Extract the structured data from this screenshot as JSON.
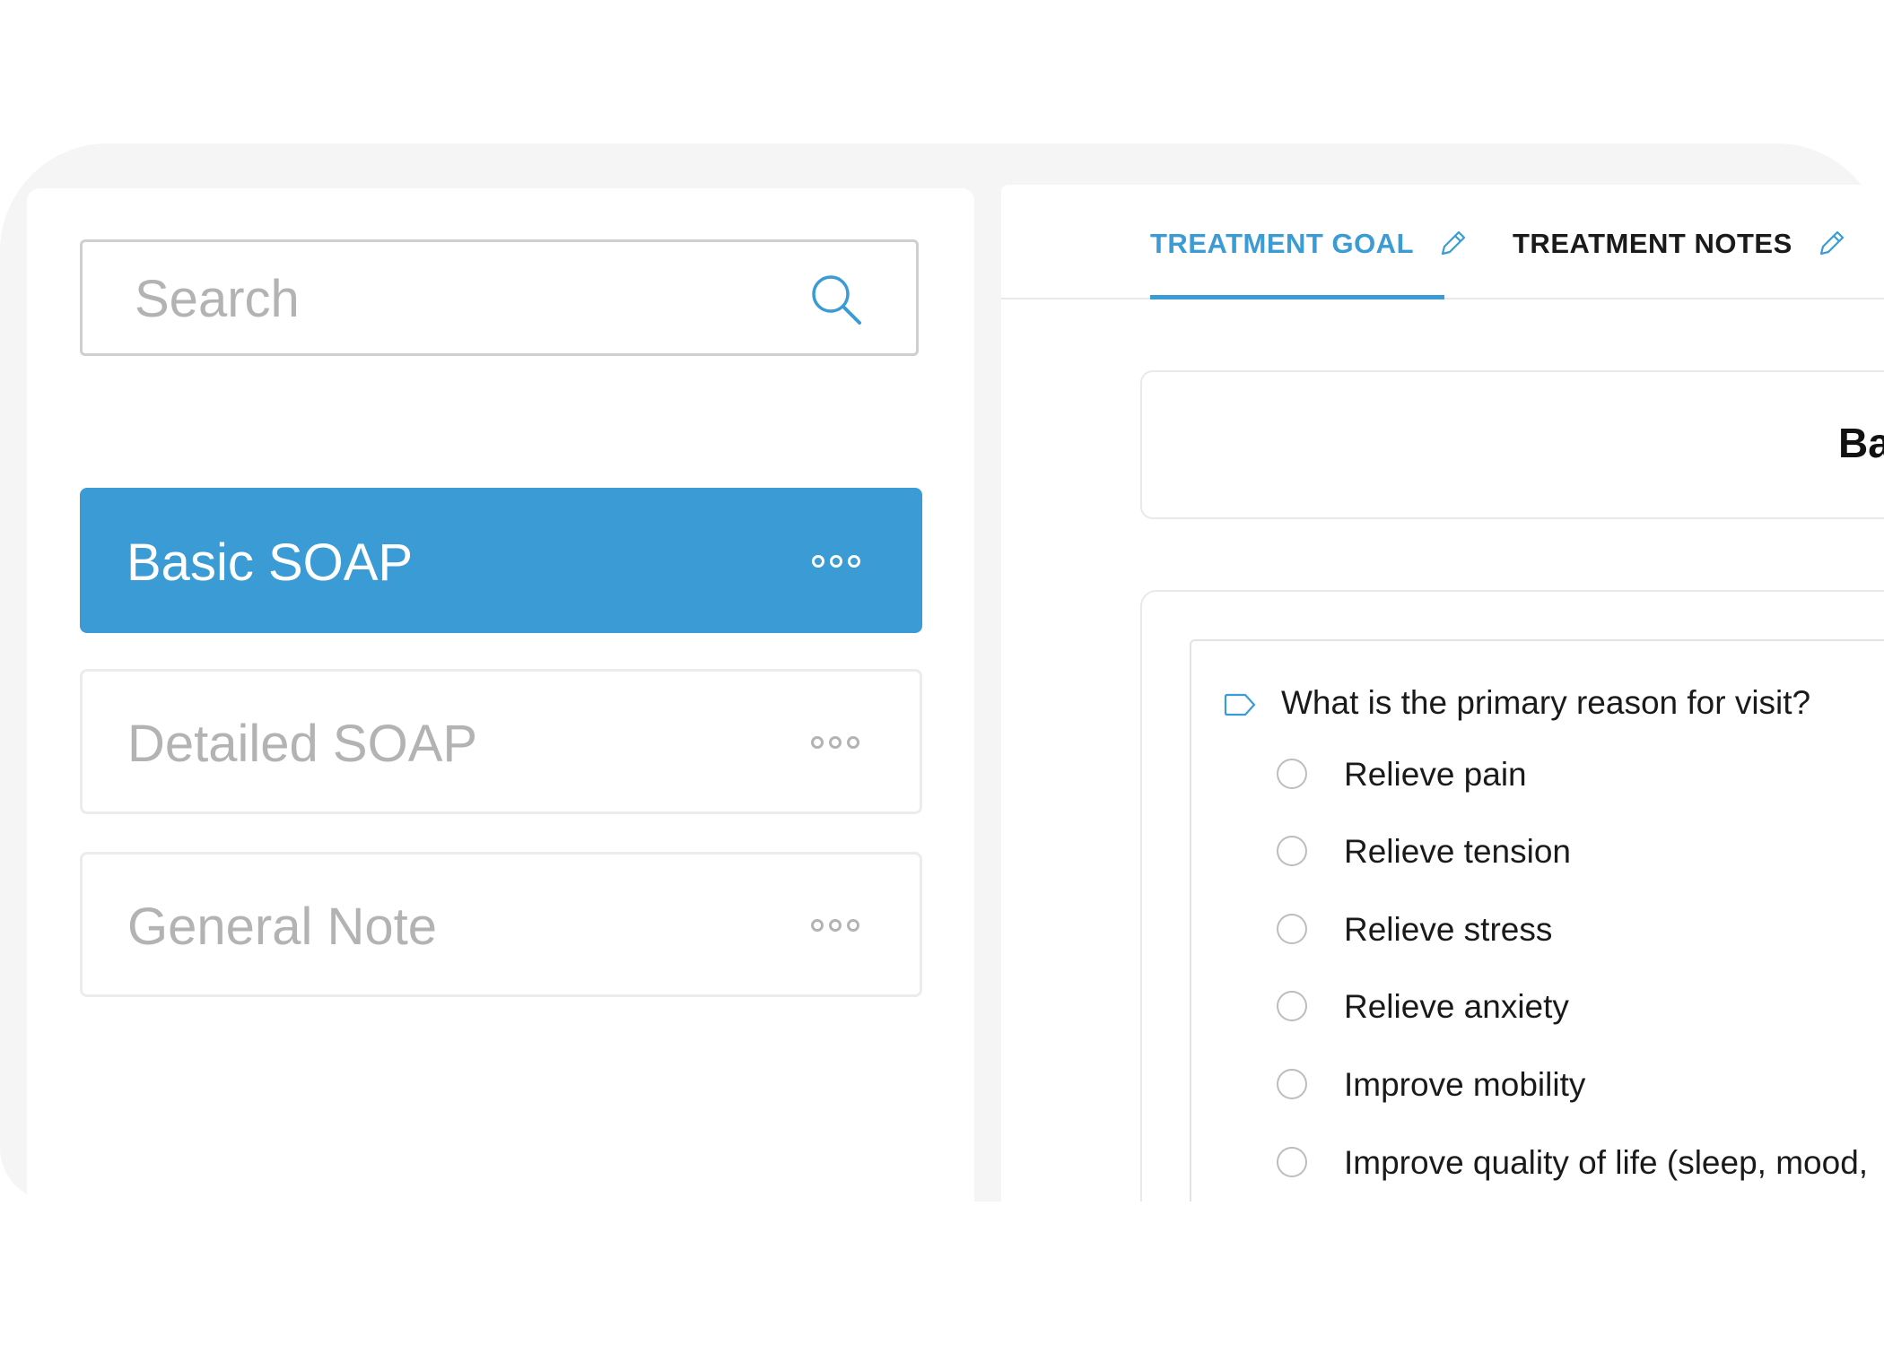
{
  "sidebar": {
    "search": {
      "placeholder": "Search",
      "icon": "search-icon"
    },
    "templates": [
      {
        "label": "Basic SOAP",
        "selected": true,
        "menu_icon": "more-options-icon"
      },
      {
        "label": "Detailed SOAP",
        "selected": false,
        "menu_icon": "more-options-icon"
      },
      {
        "label": "General Note",
        "selected": false,
        "menu_icon": "more-options-icon"
      }
    ]
  },
  "main": {
    "tabs": [
      {
        "label": "TREATMENT GOAL",
        "active": true,
        "icon": "pencil-icon"
      },
      {
        "label": "TREATMENT NOTES",
        "active": false,
        "icon": "pencil-icon"
      }
    ],
    "title_card": {
      "title": "Ba"
    },
    "question": {
      "icon": "tag-icon",
      "text": "What is the primary reason for visit?",
      "options": [
        "Relieve pain",
        "Relieve tension",
        "Relieve stress",
        "Relieve anxiety",
        "Improve mobility",
        "Improve quality of life (sleep, mood,"
      ]
    }
  },
  "colors": {
    "accent": "#3a9bd5",
    "frame_background": "#f5f5f5",
    "muted_text": "#b3b3b3",
    "primary_text": "#1a1a1a"
  }
}
